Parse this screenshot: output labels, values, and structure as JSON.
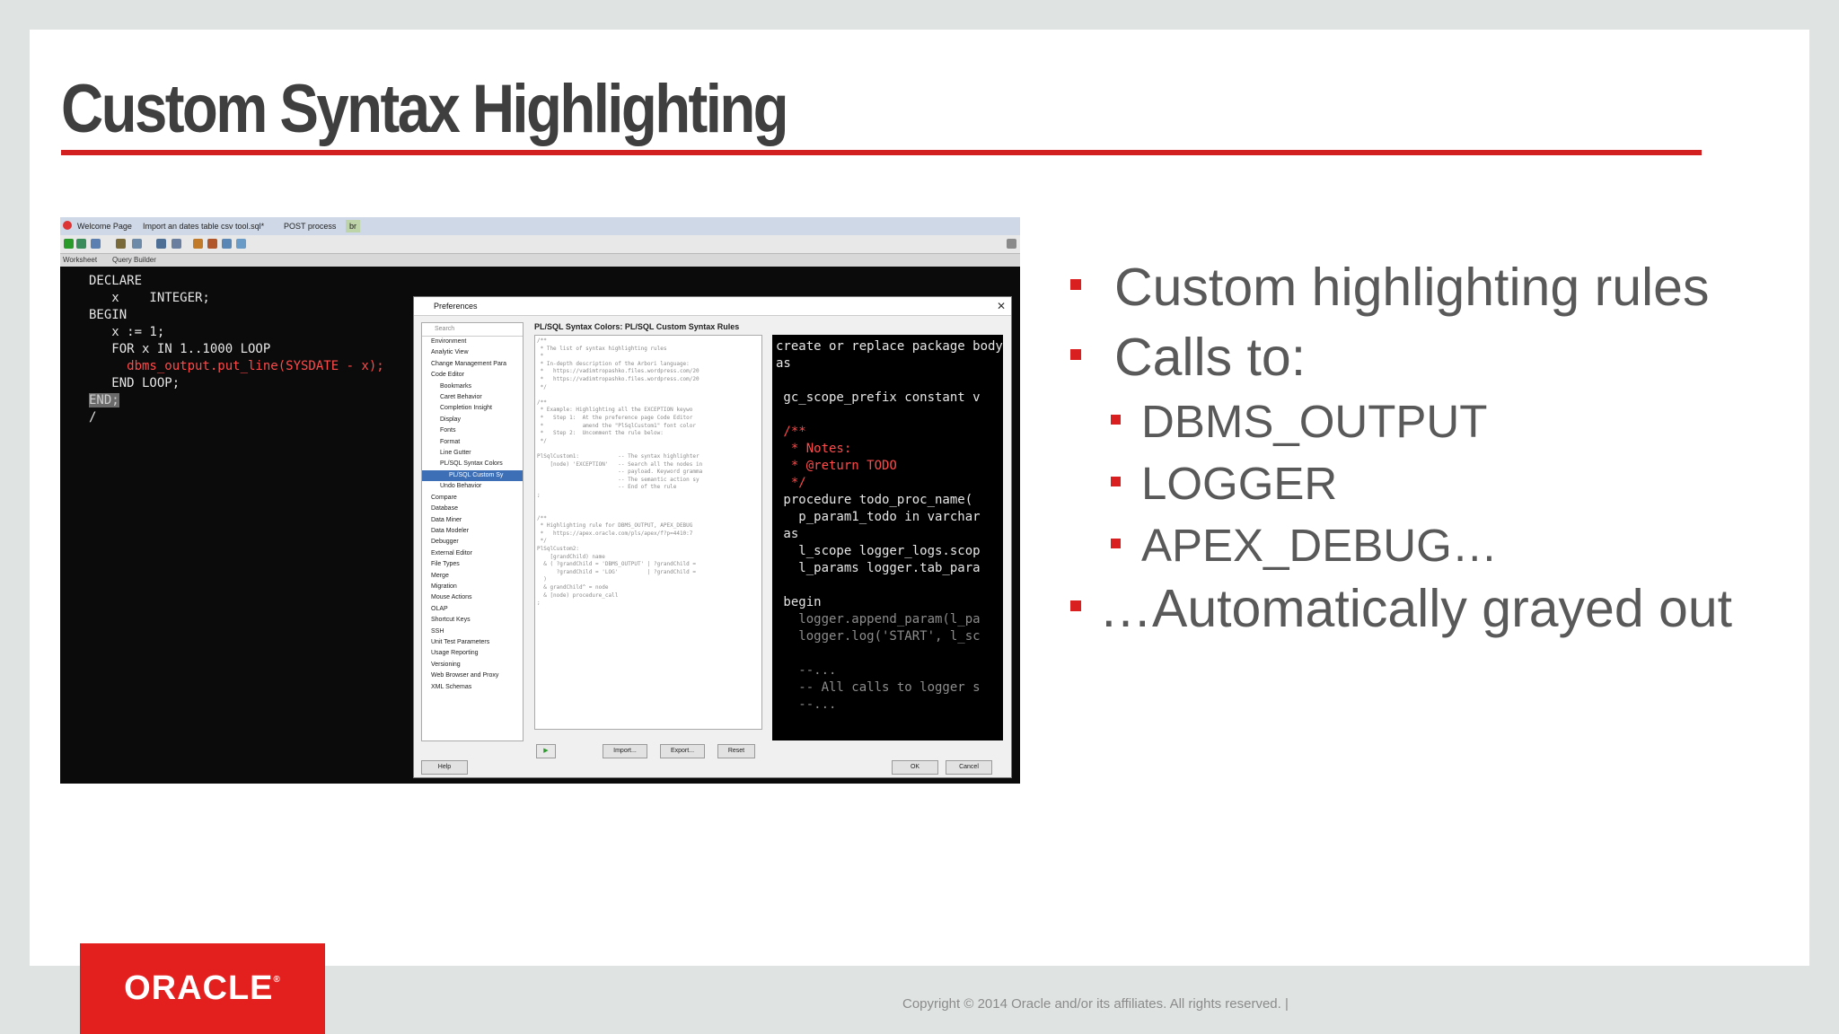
{
  "slide": {
    "title": "Custom Syntax Highlighting",
    "bullets": [
      {
        "level": 1,
        "text": "Custom highlighting rules"
      },
      {
        "level": 1,
        "text": "Calls to:"
      },
      {
        "level": 2,
        "text": "DBMS_OUTPUT"
      },
      {
        "level": 2,
        "text": "LOGGER"
      },
      {
        "level": 2,
        "text": "APEX_DEBUG…"
      },
      {
        "level": 1,
        "text": "…Automatically grayed out"
      }
    ],
    "logo": "ORACLE",
    "copyright": "Copyright © 2014 Oracle and/or its affiliates. All rights reserved.  |"
  },
  "ide": {
    "tabs": [
      "Welcome Page",
      "Import an dates table csv tool.sql*",
      "POST process",
      "br"
    ],
    "subtabs": [
      "Worksheet",
      "Query Builder"
    ],
    "editor_lines": [
      "DECLARE",
      "   x    INTEGER;",
      "BEGIN",
      "   x := 1;",
      "   FOR x IN 1..1000 LOOP",
      "     dbms_output.put_line(SYSDATE - x);",
      "   END LOOP;",
      "END;",
      "/"
    ],
    "dialog": {
      "title": "Preferences",
      "search_placeholder": "Search",
      "panel_title": "PL/SQL Syntax Colors: PL/SQL Custom Syntax Rules",
      "tree": [
        "Environment",
        "Analytic View",
        "Change Management Para",
        "Code Editor",
        "   Bookmarks",
        "   Caret Behavior",
        "   Completion Insight",
        "   Display",
        "   Fonts",
        "   Format",
        "   Line Gutter",
        "   PL/SQL Syntax Colors",
        "     PL/SQL Custom Sy",
        "   Undo Behavior",
        "Compare",
        "Database",
        "Data Miner",
        "Data Modeler",
        "Debugger",
        "External Editor",
        "File Types",
        "Merge",
        "Migration",
        "Mouse Actions",
        "OLAP",
        "Shortcut Keys",
        "SSH",
        "Unit Test Parameters",
        "Usage Reporting",
        "Versioning",
        "Web Browser and Proxy",
        "XML Schemas"
      ],
      "rules_lines": [
        "/**",
        " * The list of syntax highlighting rules",
        " *",
        " * In-depth description of the Arbori language:",
        " *   https://vadimtropashko.files.wordpress.com/20",
        " *   https://vadimtropashko.files.wordpress.com/20",
        " */",
        "",
        "/**",
        " * Example: Highlighting all the EXCEPTION keywo",
        " *   Step 1:  At the preference page Code Editor",
        " *            amend the \"PlSqlCustom1\" font color",
        " *   Step 2:  Uncomment the rule below:",
        " */",
        "",
        "PlSqlCustom1:            -- The syntax highlighter",
        "    [node) 'EXCEPTION'   -- Search all the nodes in",
        "                         -- payload. Keyword gramma",
        "                         -- The semantic action sy",
        "                         -- End of the rule",
        ";",
        "",
        "",
        "/**",
        " * Highlighting rule for DBMS_OUTPUT, APEX_DEBUG",
        " *   https://apex.oracle.com/pls/apex/f?p=4410:7",
        " */",
        "PlSqlCustom2:",
        "    [grandChild) name",
        "  & ( ?grandChild = 'DBMS_OUTPUT' | ?grandChild =",
        "      ?grandChild = 'LOG'         | ?grandChild =",
        "  )",
        "  & grandChild^ = node",
        "  & [node) procedure_call",
        ";"
      ],
      "preview_lines": [
        {
          "t": "create or replace package body",
          "c": ""
        },
        {
          "t": "as",
          "c": ""
        },
        {
          "t": "",
          "c": ""
        },
        {
          "t": " gc_scope_prefix constant v",
          "c": ""
        },
        {
          "t": "",
          "c": ""
        },
        {
          "t": " /**",
          "c": "red"
        },
        {
          "t": "  * Notes:",
          "c": "red"
        },
        {
          "t": "  * @return TODO",
          "c": "red"
        },
        {
          "t": "  */",
          "c": "red"
        },
        {
          "t": " procedure todo_proc_name(",
          "c": ""
        },
        {
          "t": "   p_param1_todo in varchar",
          "c": ""
        },
        {
          "t": " as",
          "c": ""
        },
        {
          "t": "   l_scope logger_logs.scop",
          "c": ""
        },
        {
          "t": "   l_params logger.tab_para",
          "c": ""
        },
        {
          "t": "",
          "c": ""
        },
        {
          "t": " begin",
          "c": ""
        },
        {
          "t": "   logger.append_param(l_pa",
          "c": "gray"
        },
        {
          "t": "   logger.log('START', l_sc",
          "c": "gray"
        },
        {
          "t": "",
          "c": ""
        },
        {
          "t": "   --...",
          "c": "gray"
        },
        {
          "t": "   -- All calls to logger s",
          "c": "gray"
        },
        {
          "t": "   --...",
          "c": "gray"
        }
      ],
      "buttons": {
        "import": "Import...",
        "export": "Export...",
        "reset": "Reset",
        "help": "Help",
        "ok": "OK",
        "cancel": "Cancel"
      }
    }
  },
  "colors": {
    "accent": "#d21f1f",
    "logo": "#e4201f",
    "title": "#3f3f3f",
    "bullet_text": "#595959"
  }
}
